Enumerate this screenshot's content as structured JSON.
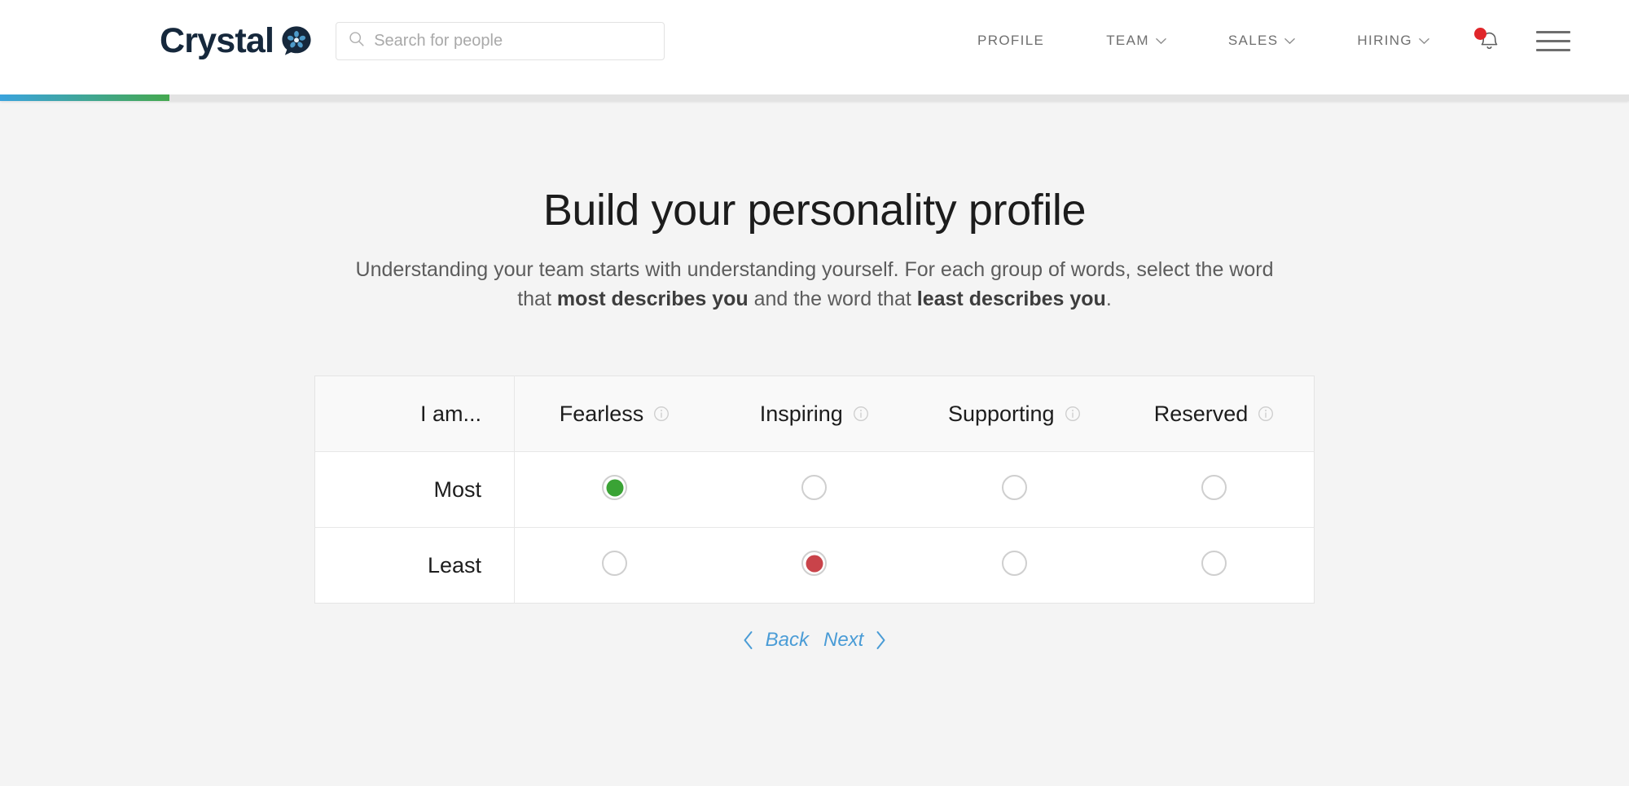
{
  "header": {
    "logo_text": "Crystal",
    "logo_icon": "crystal-bubble-logo",
    "search": {
      "placeholder": "Search for people",
      "value": "",
      "icon": "search-icon"
    },
    "nav": [
      {
        "label": "PROFILE",
        "has_dropdown": false
      },
      {
        "label": "TEAM",
        "has_dropdown": true
      },
      {
        "label": "SALES",
        "has_dropdown": true
      },
      {
        "label": "HIRING",
        "has_dropdown": true
      }
    ],
    "notifications": {
      "icon": "bell-icon",
      "badge": true,
      "badge_color": "#e0262a"
    },
    "menu": {
      "icon": "hamburger-icon"
    },
    "progress": {
      "percent": 10.4,
      "gradient_from": "#3aa3dd",
      "gradient_to": "#45a84f"
    }
  },
  "main": {
    "title": "Build your personality profile",
    "subtitle_part1": "Understanding your team starts with understanding yourself. For each group of words, select the word that ",
    "subtitle_bold1": "most describes you",
    "subtitle_part2": " and the word that ",
    "subtitle_bold2": "least describes you",
    "subtitle_part3": "."
  },
  "quiz": {
    "header_label": "I am...",
    "words": [
      {
        "label": "Fearless",
        "info_icon": "info-icon"
      },
      {
        "label": "Inspiring",
        "info_icon": "info-icon"
      },
      {
        "label": "Supporting",
        "info_icon": "info-icon"
      },
      {
        "label": "Reserved",
        "info_icon": "info-icon"
      }
    ],
    "rows": [
      {
        "label": "Most",
        "selected_index": 0,
        "selected_color": "#3aa335"
      },
      {
        "label": "Least",
        "selected_index": 1,
        "selected_color": "#c9434a"
      }
    ]
  },
  "pager": {
    "back_label": "Back",
    "next_label": "Next",
    "prev_icon": "chevron-left-icon",
    "next_icon": "chevron-right-icon"
  }
}
